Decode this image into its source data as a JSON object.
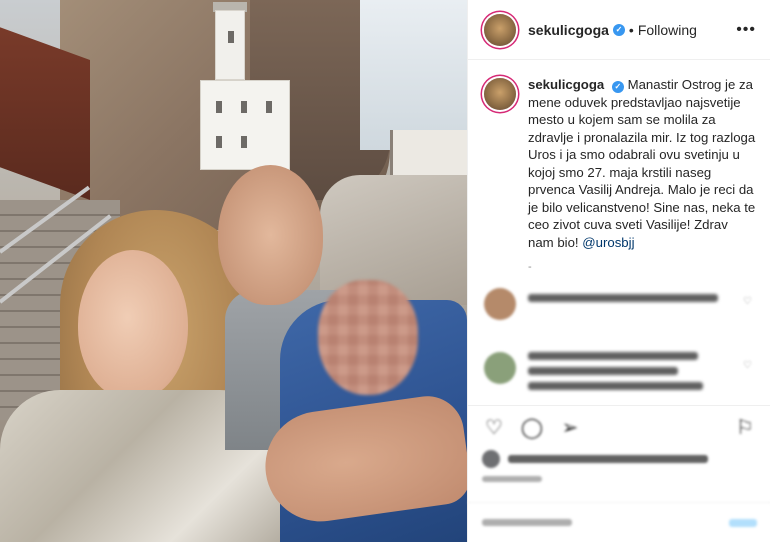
{
  "post": {
    "author": {
      "username": "sekulicgoga",
      "verified": true,
      "follow_status": "Following",
      "separator": "•"
    },
    "more_options_icon": "more-horizontal-icon",
    "caption": {
      "text": "Manastir Ostrog je za mene oduvek predstavljao najsvetije mesto u kojem sam se molila za zdravlje i pronalazila mir. Iz tog razloga Uros i ja smo odabrali ovu svetinju u kojoj smo 27. maja krstili naseg prvenca Vasilij Andreja. Malo je reci da je bilo velicanstveno! Sine nas, neka te ceo zivot cuva sveti Vasilije! Zdrav nam bio!",
      "mention": "@urosbjj",
      "trailing_mark": "-"
    },
    "comments": [
      {
        "avatar_color": "#b58a6a"
      },
      {
        "avatar_color": "#8aa07a"
      }
    ],
    "actions": {
      "like_icon": "heart-icon",
      "comment_icon": "comment-icon",
      "share_icon": "share-icon",
      "save_icon": "bookmark-icon"
    },
    "colors": {
      "verified_badge": "#3897f0",
      "mention": "#00376b",
      "text": "#262626",
      "muted": "#8e8e8e",
      "story_ring": "#d62976"
    }
  }
}
